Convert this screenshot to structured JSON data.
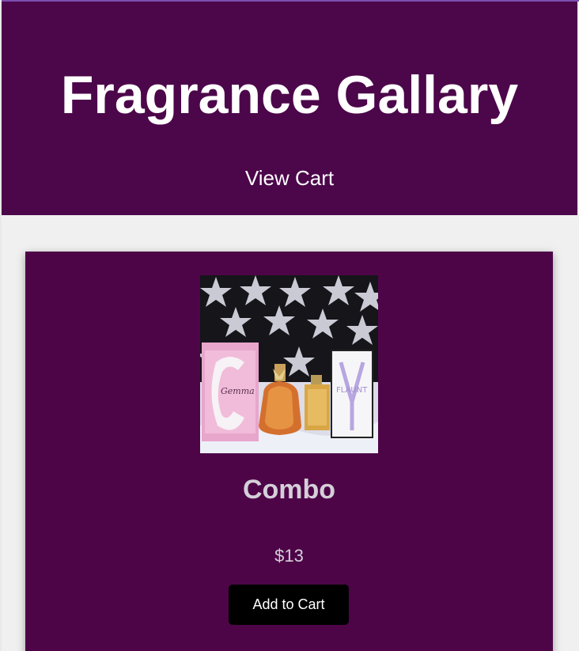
{
  "header": {
    "title": "Fragrance Gallary",
    "view_cart_label": "View Cart"
  },
  "product": {
    "name": "Combo",
    "price": "$13",
    "add_to_cart_label": "Add to Cart",
    "image_alt": "Combo",
    "packaging_text": {
      "left_box": "Gemma",
      "right_box": "FLAUNT"
    }
  },
  "colors": {
    "header_bg": "#4c064a",
    "card_bg": "#4d0548",
    "page_bg": "#f0f0f0",
    "button_bg": "#000000",
    "title_text": "#ffffff",
    "card_text": "#d4cfd8"
  }
}
